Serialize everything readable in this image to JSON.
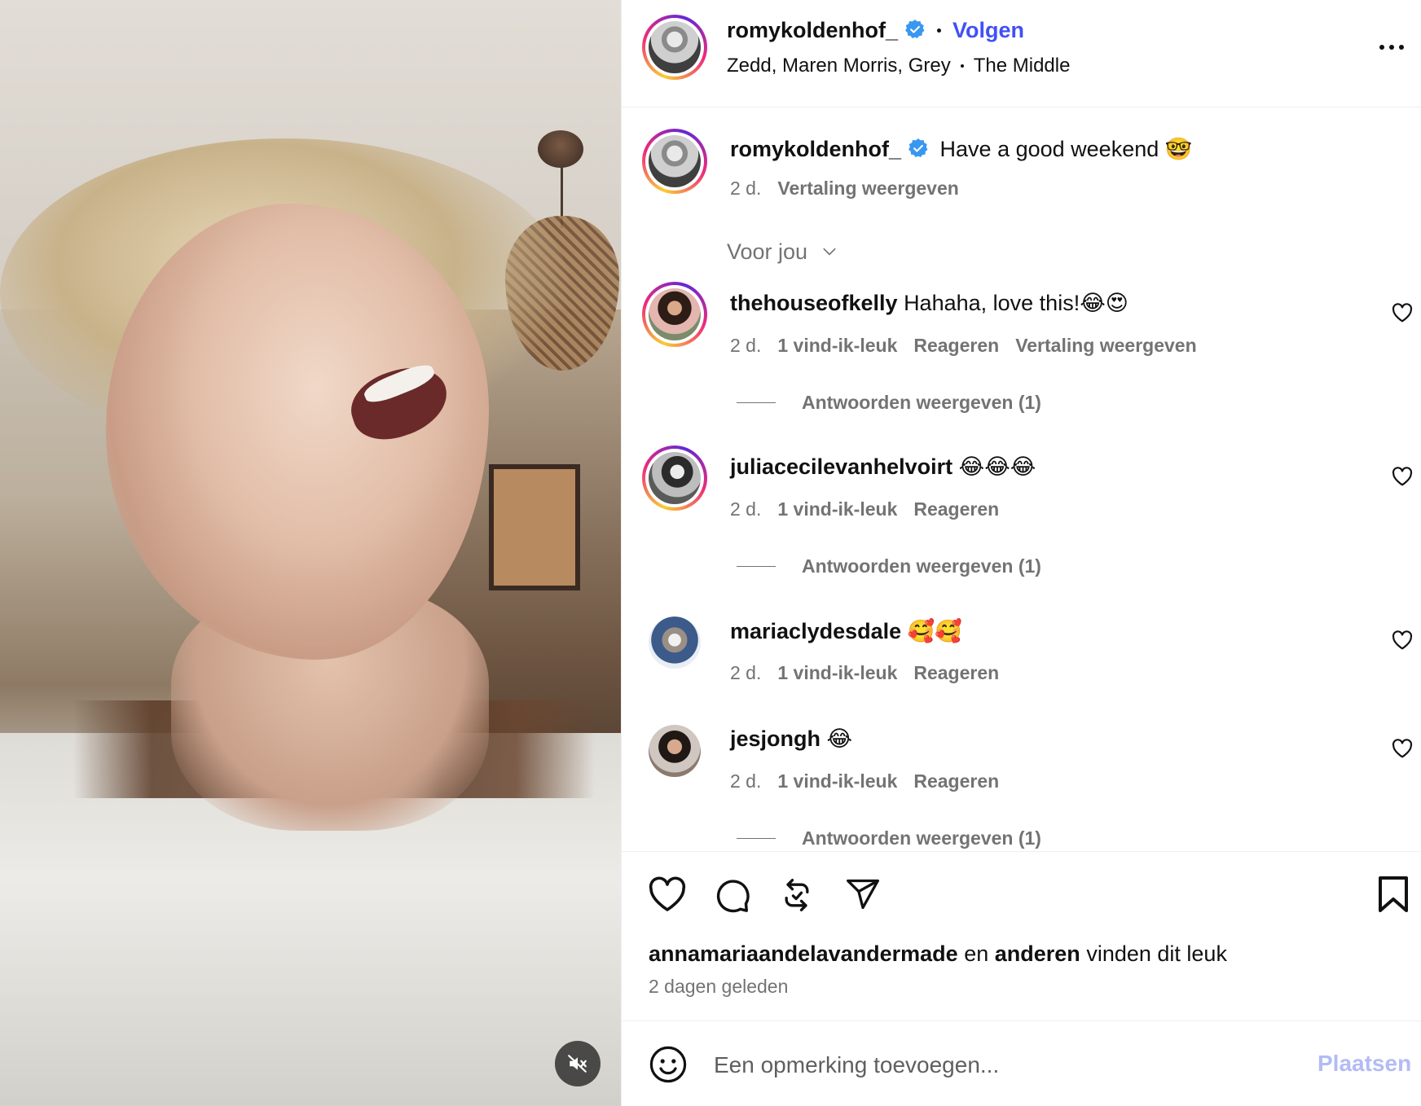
{
  "header": {
    "username": "romykoldenhof_",
    "follow_label": "Volgen",
    "audio_artists": "Zedd, Maren Morris, Grey",
    "audio_track": "The Middle"
  },
  "caption": {
    "username": "romykoldenhof_",
    "text": "Have a good weekend 🤓",
    "time": "2 d.",
    "translate_label": "Vertaling weergeven"
  },
  "comments_filter": "Voor jou",
  "comments": [
    {
      "username": "thehouseofkelly",
      "text": "Hahaha, love this!😂😍",
      "time": "2 d.",
      "likes": "1 vind-ik-leuk",
      "reply_label": "Reageren",
      "translate_label": "Vertaling weergeven",
      "replies_label": "Antwoorden weergeven (1)"
    },
    {
      "username": "juliacecilevanhelvoirt",
      "text": "😂😂😂",
      "time": "2 d.",
      "likes": "1 vind-ik-leuk",
      "reply_label": "Reageren",
      "replies_label": "Antwoorden weergeven (1)"
    },
    {
      "username": "mariaclydesdale",
      "text": "🥰🥰",
      "time": "2 d.",
      "likes": "1 vind-ik-leuk",
      "reply_label": "Reageren"
    },
    {
      "username": "jesjongh",
      "text": "😂",
      "time": "2 d.",
      "likes": "1 vind-ik-leuk",
      "reply_label": "Reageren",
      "replies_label": "Antwoorden weergeven (1)"
    }
  ],
  "likes_summary": {
    "user": "annamariaandelavandermade",
    "connector": "en",
    "others": "anderen",
    "suffix": "vinden dit leuk"
  },
  "posted_ago": "2 dagen geleden",
  "composer": {
    "placeholder": "Een opmerking toevoegen...",
    "post_label": "Plaatsen"
  },
  "icons": [
    "volume-muted-icon",
    "verified-badge-icon",
    "more-options-icon",
    "chevron-down-icon",
    "heart-icon",
    "comment-icon",
    "repost-icon",
    "share-icon",
    "bookmark-icon",
    "emoji-icon"
  ],
  "colors": {
    "accent": "#4150f7",
    "verified": "#3897f0",
    "muted_text": "#737373",
    "post_disabled": "#b3bbf5",
    "divider": "#efefef"
  }
}
